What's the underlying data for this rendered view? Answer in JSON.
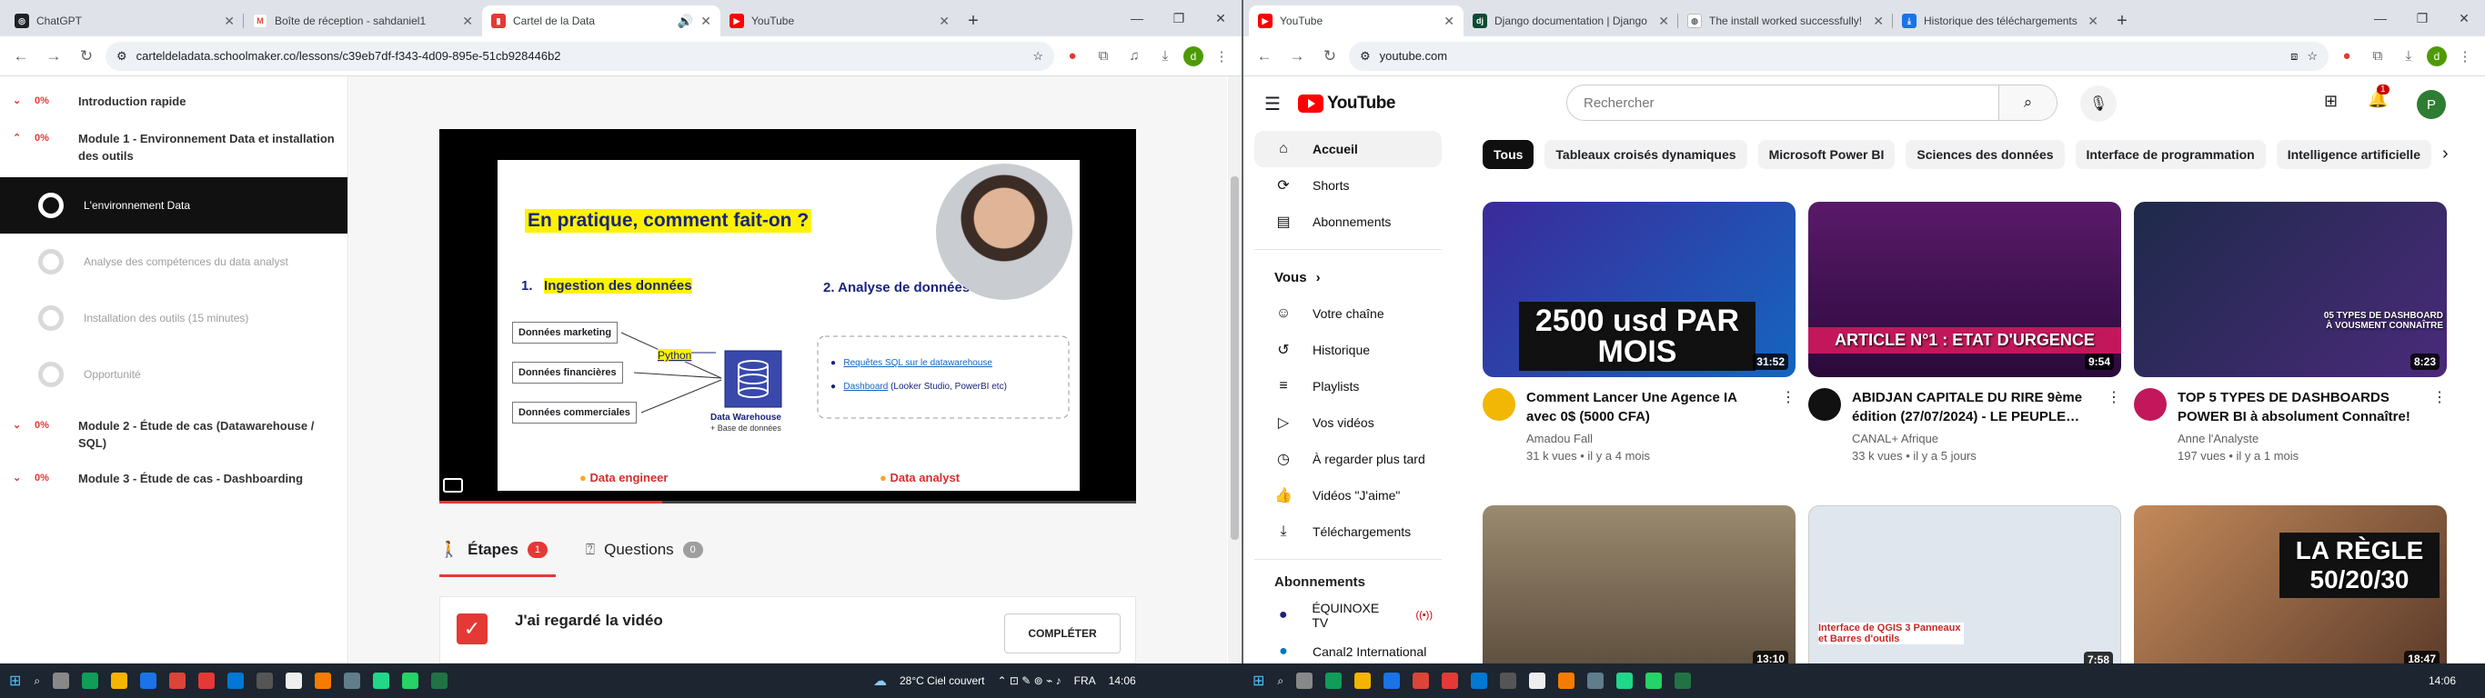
{
  "left_window": {
    "tabs": [
      {
        "title": "ChatGPT",
        "favicon": "chatgpt-icon",
        "color": "#202124"
      },
      {
        "title": "Boîte de réception - sahdaniel1",
        "favicon": "gmail-icon",
        "color": "#ea4335"
      },
      {
        "title": "Cartel de la Data",
        "favicon": "cartel-icon",
        "color": "#e53935"
      },
      {
        "title": "YouTube",
        "favicon": "youtube-icon",
        "color": "#ff0000"
      }
    ],
    "url": "carteldeladata.schoolmaker.co/lessons/c39eb7df-f343-4d09-895e-51cb928446b2",
    "profile_initial": "d"
  },
  "course": {
    "modules": [
      {
        "percent": "0%",
        "title": "Introduction rapide"
      },
      {
        "percent": "0%",
        "title": "Module 1 - Environnement Data et installation des outils"
      },
      {
        "percent": "0%",
        "title": "Module 2 - Étude de cas (Datawarehouse / SQL)"
      },
      {
        "percent": "0%",
        "title": "Module 3 - Étude de cas - Dashboarding"
      }
    ],
    "lessons": [
      {
        "title": "L'environnement Data"
      },
      {
        "title": "Analyse des compétences du data analyst"
      },
      {
        "title": "Installation des outils (15 minutes)"
      },
      {
        "title": "Opportunité"
      }
    ],
    "slide": {
      "title": "En pratique, comment fait-on ?",
      "section1": "1.",
      "section1_label": "Ingestion des données",
      "section2": "2. Analyse de données",
      "boxes": [
        "Données marketing",
        "Données financières",
        "Données commerciales"
      ],
      "python": "Python",
      "warehouse": "Data Warehouse",
      "warehouse_sub": "+ Base de données",
      "bullets": [
        "Requêtes SQL sur le datawarehouse",
        "Dashboard"
      ],
      "bullet2_rest": " (Looker Studio, PowerBI etc)",
      "role1": "Data engineer",
      "role2": "Data analyst"
    },
    "tabs": {
      "steps_label": "Étapes",
      "steps_count": "1",
      "questions_label": "Questions",
      "questions_count": "0"
    },
    "task": {
      "label": "J'ai regardé la vidéo",
      "button": "COMPLÉTER"
    }
  },
  "right_window": {
    "tabs": [
      {
        "title": "YouTube",
        "favicon": "youtube-icon",
        "color": "#ff0000"
      },
      {
        "title": "Django documentation | Django",
        "favicon": "django-icon",
        "color": "#0c4b33"
      },
      {
        "title": "The install worked successfully!",
        "favicon": "globe-icon",
        "color": "#5f6368"
      },
      {
        "title": "Historique des téléchargements",
        "favicon": "download-icon",
        "color": "#1a73e8"
      }
    ],
    "url": "youtube.com",
    "profile_initial": "d"
  },
  "youtube": {
    "logo": "YouTube",
    "search_placeholder": "Rechercher",
    "notif_count": "1",
    "avatar": "P",
    "nav": [
      {
        "label": "Accueil",
        "icon": "home-icon"
      },
      {
        "label": "Shorts",
        "icon": "shorts-icon"
      },
      {
        "label": "Abonnements",
        "icon": "subscriptions-icon"
      }
    ],
    "you_header": "Vous",
    "you_items": [
      {
        "label": "Votre chaîne",
        "icon": "channel-icon"
      },
      {
        "label": "Historique",
        "icon": "history-icon"
      },
      {
        "label": "Playlists",
        "icon": "playlist-icon"
      },
      {
        "label": "Vos vidéos",
        "icon": "video-icon"
      },
      {
        "label": "À regarder plus tard",
        "icon": "clock-icon"
      },
      {
        "label": "Vidéos \"J'aime\"",
        "icon": "like-icon"
      },
      {
        "label": "Téléchargements",
        "icon": "download-icon"
      }
    ],
    "subs_header": "Abonnements",
    "subs": [
      {
        "label": "ÉQUINOXE TV"
      },
      {
        "label": "Canal2 International"
      }
    ],
    "chips": [
      "Tous",
      "Tableaux croisés dynamiques",
      "Microsoft Power BI",
      "Sciences des données",
      "Interface de programmation",
      "Intelligence artificielle"
    ],
    "videos": [
      {
        "title": "Comment Lancer Une Agence IA avec 0$ (5000 CFA)",
        "channel": "Amadou Fall",
        "meta": "31 k vues • il y a 4 mois",
        "duration": "31:52",
        "thumb_text": "2500 usd PAR MOIS",
        "bg": "#2a3a8a",
        "avatar_color": "#f2b705"
      },
      {
        "title": "ABIDJAN CAPITALE DU RIRE 9ème édition (27/07/2024) - LE PEUPLE…",
        "channel": "CANAL+ Afrique",
        "meta": "33 k vues • il y a 5 jours",
        "duration": "9:54",
        "thumb_text": "ARTICLE N°1 : ETAT D'URGENCE",
        "bg": "#4a1a5a",
        "avatar_color": "#111111"
      },
      {
        "title": "TOP 5 TYPES DE DASHBOARDS POWER BI à absolument Connaître!",
        "channel": "Anne l'Analyste",
        "meta": "197 vues • il y a 1 mois",
        "duration": "8:23",
        "thumb_text": "05 TYPES DE DASHBOARD À VOUSMENT CONNAÎTRE",
        "bg": "#4a2a7a",
        "avatar_color": "#c2185b"
      },
      {
        "title": "",
        "channel": "",
        "meta": "",
        "duration": "13:10",
        "thumb_text": "",
        "bg": "#8a7a60",
        "avatar_color": "#888888"
      },
      {
        "title": "",
        "channel": "",
        "meta": "",
        "duration": "7:58",
        "thumb_text": "Interface de QGIS 3 Panneaux et Barres d'outils",
        "bg": "#dfe6ee",
        "avatar_color": "#888888"
      },
      {
        "title": "",
        "channel": "",
        "meta": "",
        "duration": "18:47",
        "thumb_text": "LA RÈGLE 50/20/30",
        "bg": "#8a5a3a",
        "avatar_color": "#888888"
      }
    ]
  },
  "taskbar": {
    "weather": "28°C  Ciel couvert",
    "lang": "FRA",
    "time": "14:06"
  }
}
